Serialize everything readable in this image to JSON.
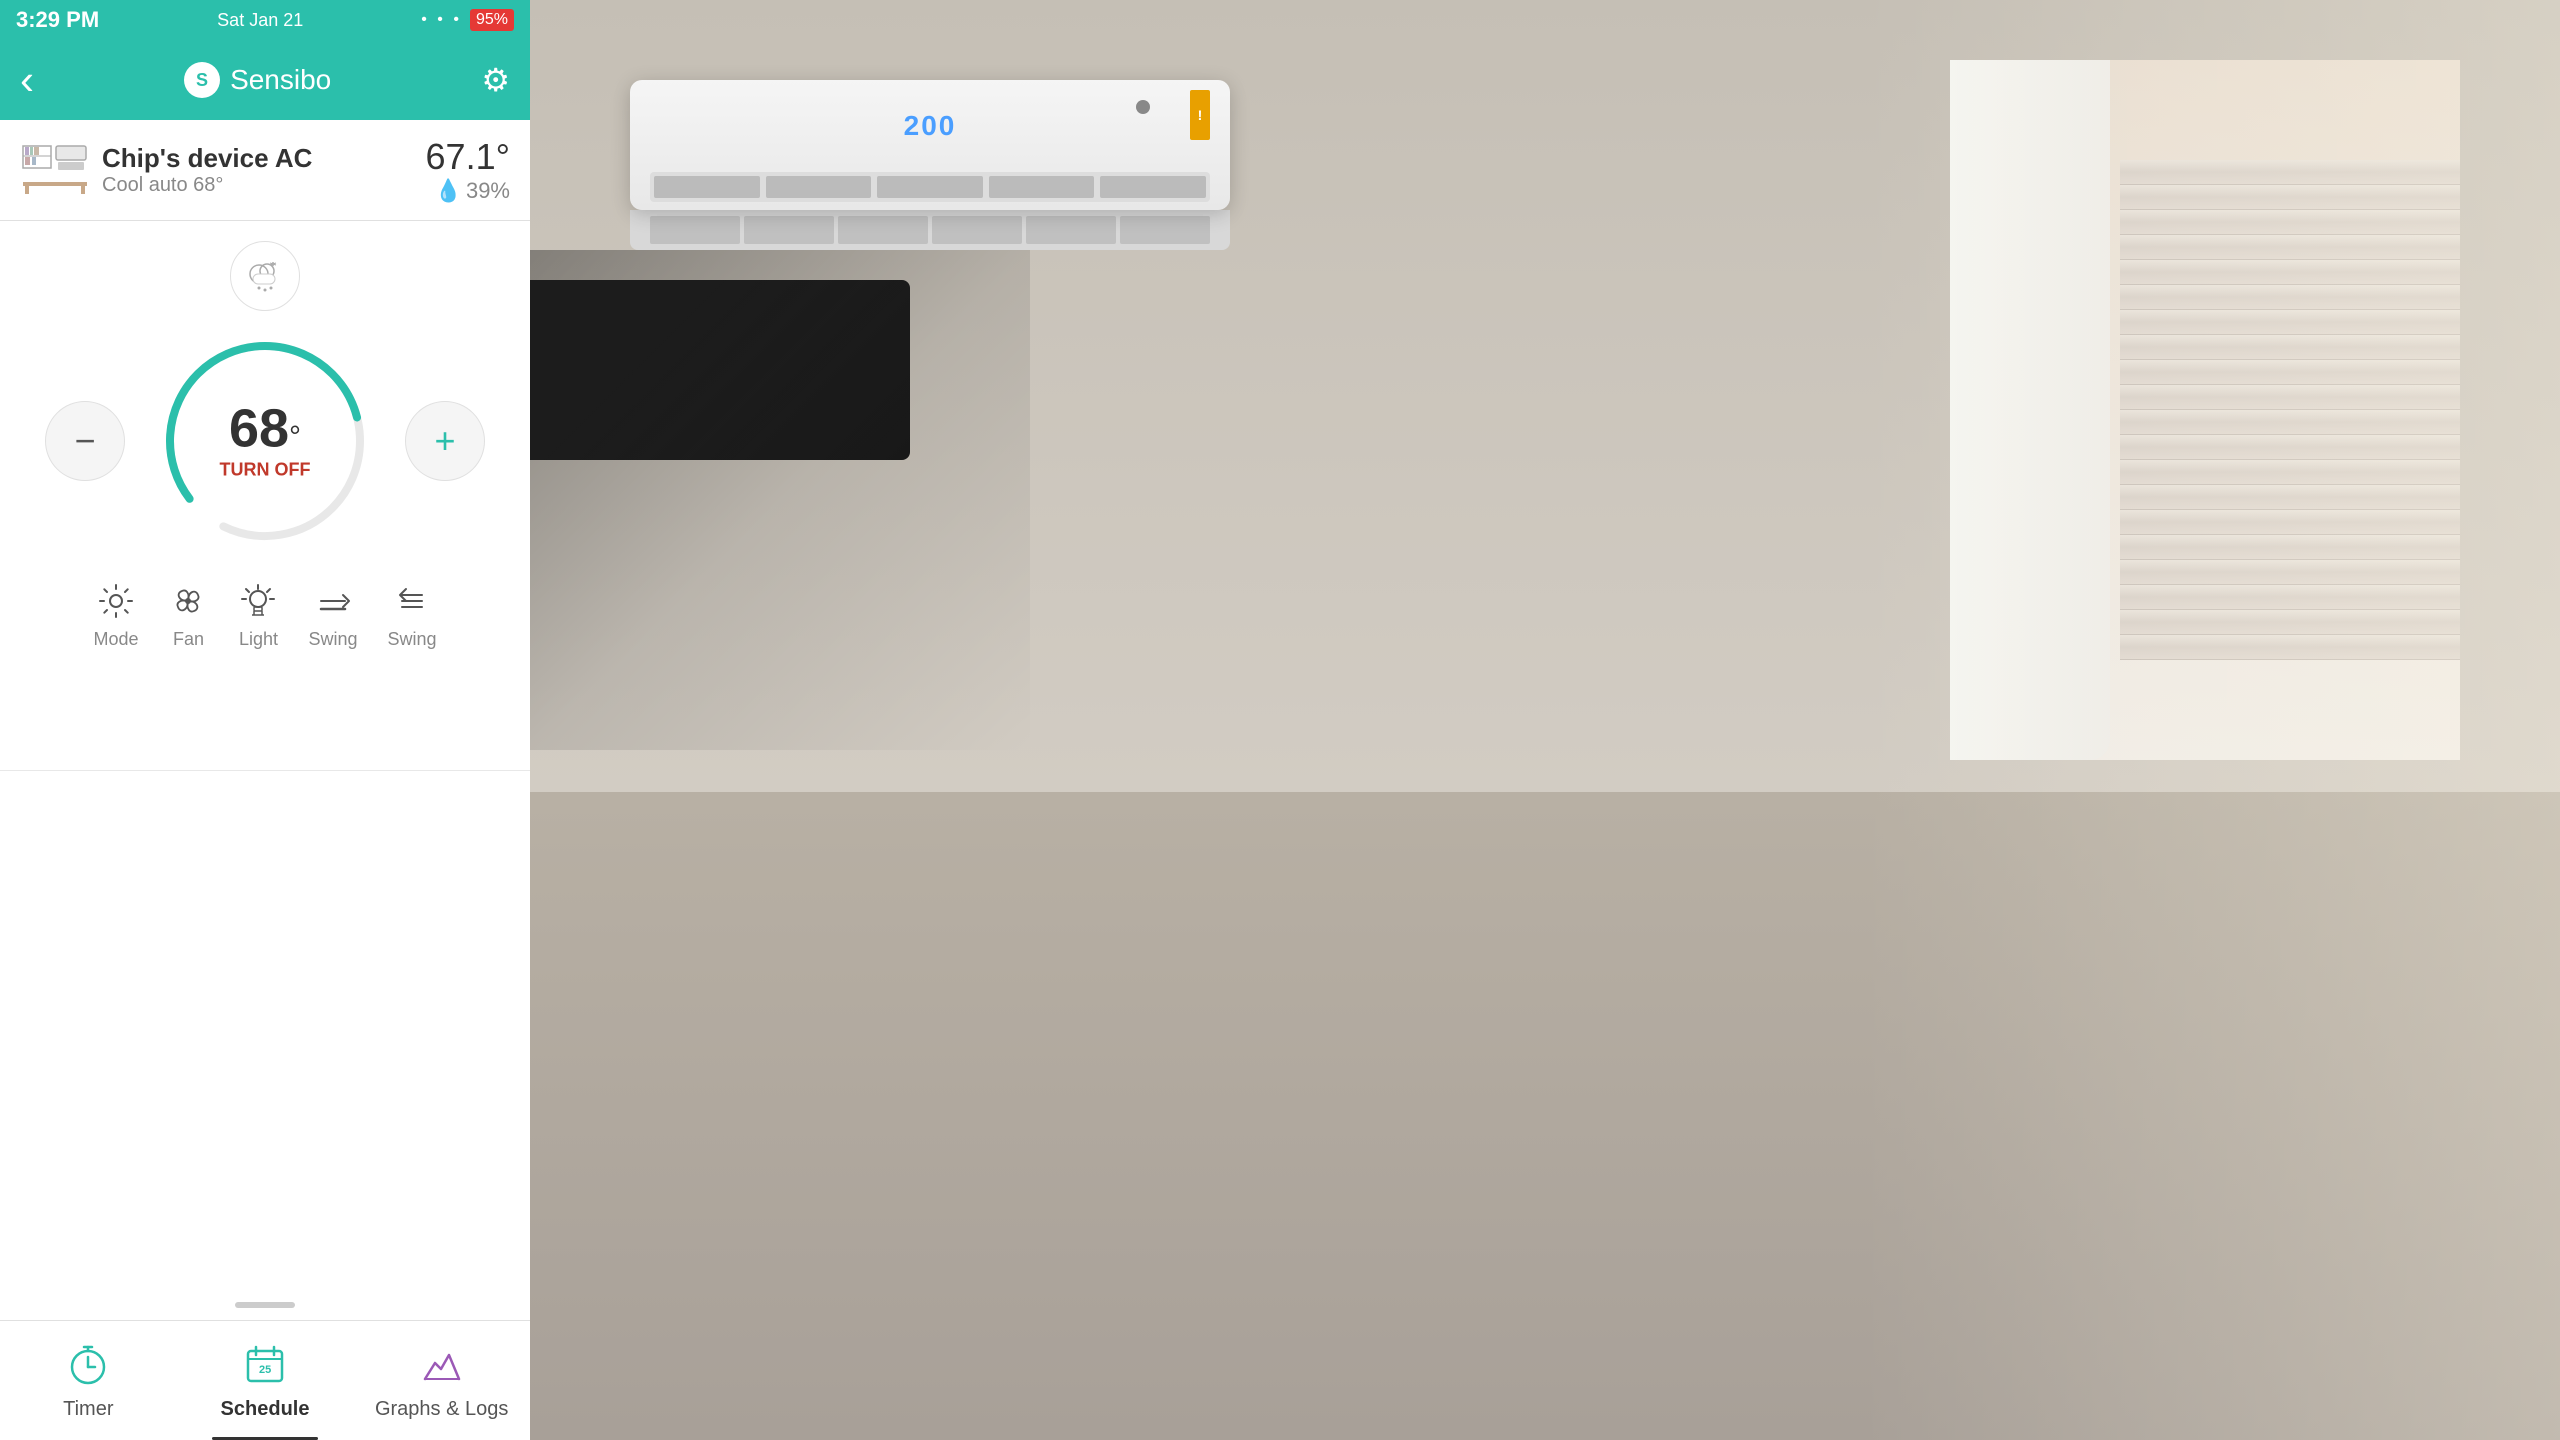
{
  "statusBar": {
    "time": "3:29 PM",
    "date": "Sat Jan 21",
    "battery": "95%",
    "wifiDots": "• • •"
  },
  "nav": {
    "title": "Sensibo",
    "backLabel": "‹",
    "settingsLabel": "⚙"
  },
  "device": {
    "name": "Chip's device AC",
    "mode": "Cool auto 68°",
    "temperature": "67.1°",
    "humidity": "39%"
  },
  "thermostat": {
    "setTemp": "68",
    "unit": "°",
    "turnOffLabel": "TURN OFF",
    "decreaseLabel": "−",
    "increaseLabel": "+"
  },
  "controls": [
    {
      "id": "mode",
      "icon": "❄",
      "label": "Mode"
    },
    {
      "id": "fan",
      "icon": "✂",
      "label": "Fan"
    },
    {
      "id": "light",
      "icon": "✦",
      "label": "Light"
    },
    {
      "id": "swing1",
      "icon": "⊣",
      "label": "Swing"
    },
    {
      "id": "swing2",
      "icon": "≡",
      "label": "Swing"
    }
  ],
  "bottomTabs": [
    {
      "id": "timer",
      "label": "Timer",
      "icon": "⏱",
      "active": false
    },
    {
      "id": "schedule",
      "label": "Schedule",
      "active": true
    },
    {
      "id": "graphs",
      "label": "Graphs & Logs",
      "icon": "📊",
      "active": false
    }
  ],
  "icons": {
    "weather": "⛅",
    "back": "‹",
    "settings": "⚙",
    "drop": "💧",
    "ac": "🌡",
    "leaf": "🌿"
  }
}
